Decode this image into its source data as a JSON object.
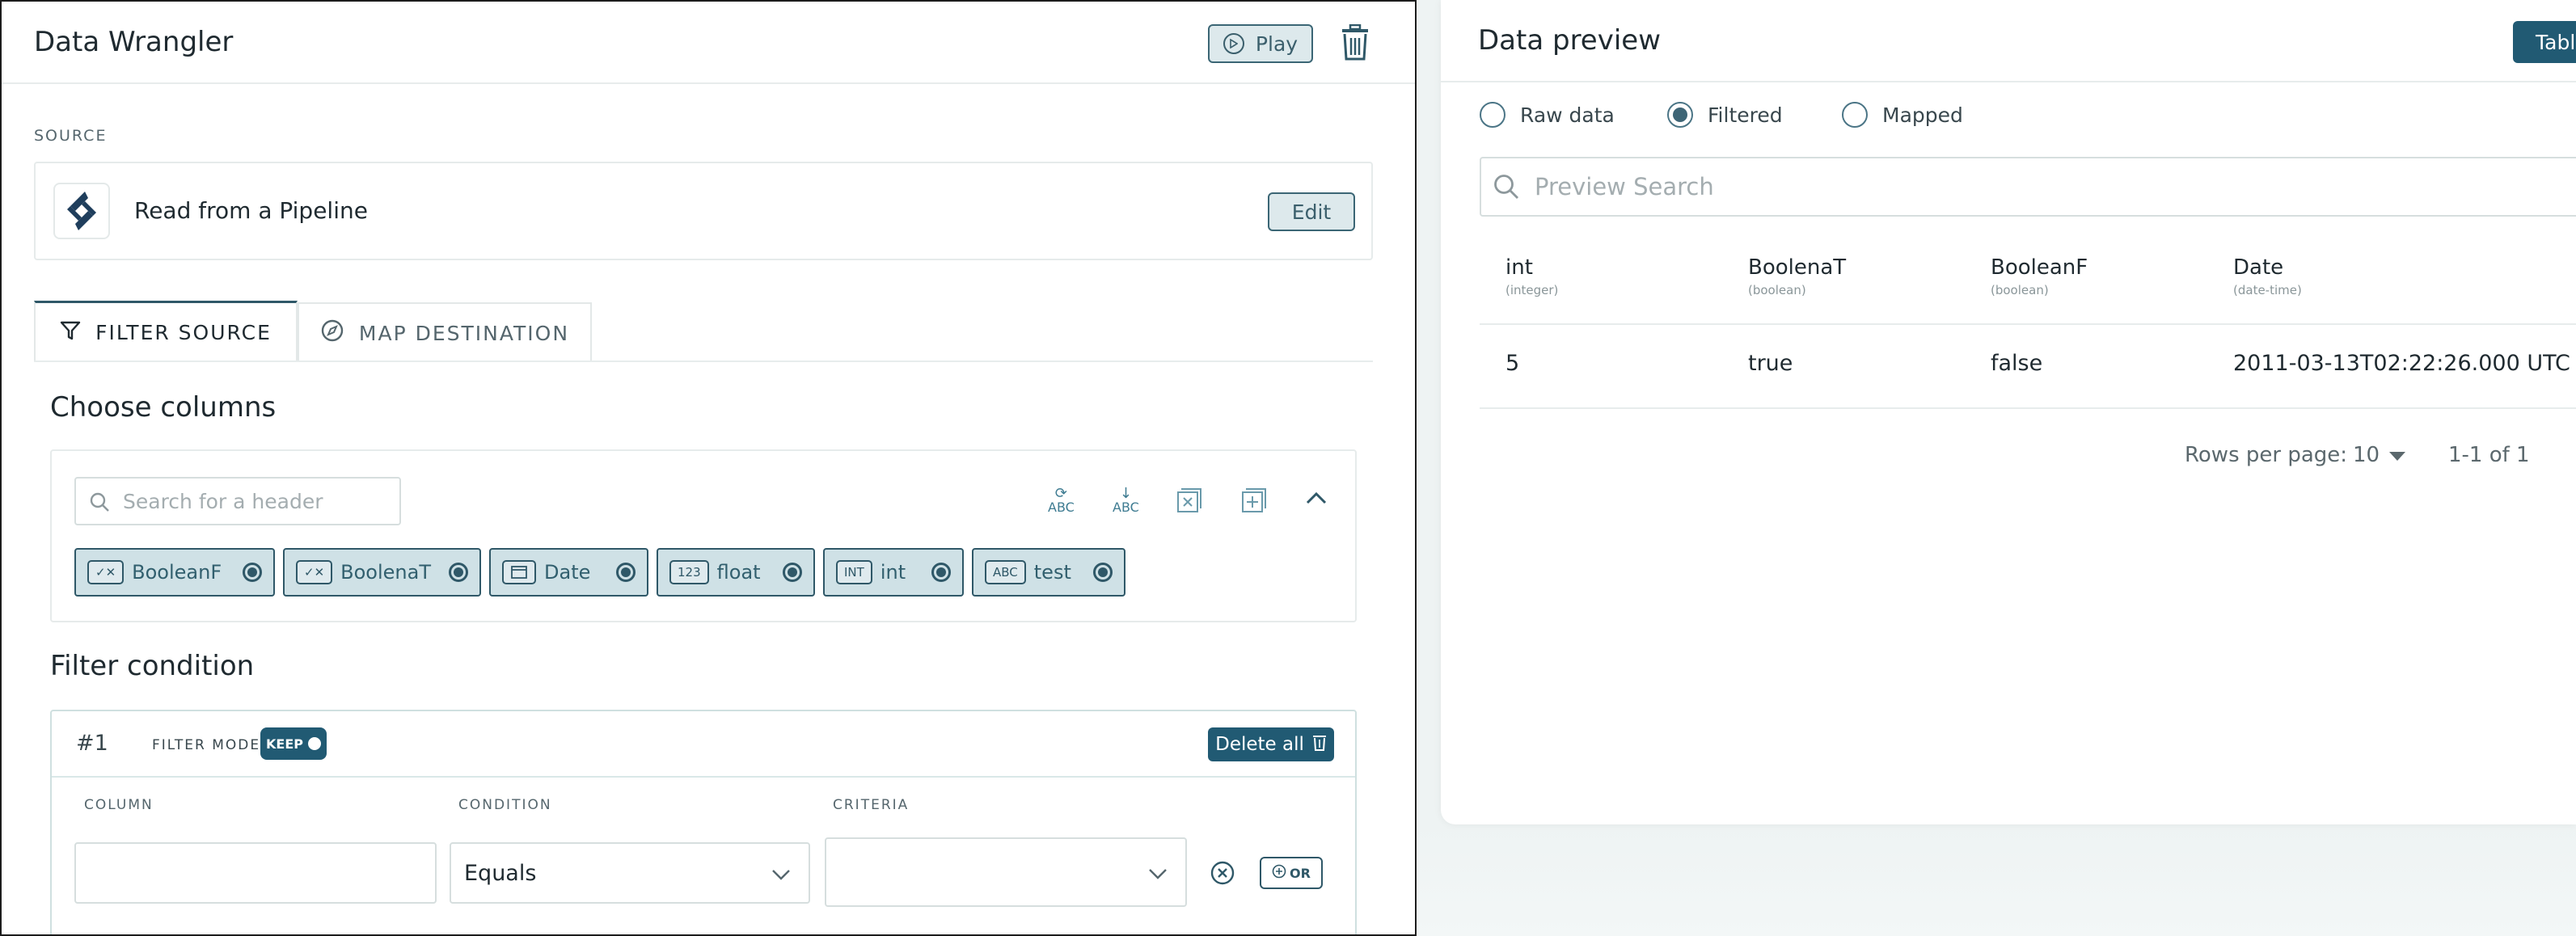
{
  "app": {
    "title": "Data Wrangler"
  },
  "header": {
    "play_label": "Play",
    "delete_icon": "trash-icon"
  },
  "source": {
    "section_label": "SOURCE",
    "pipeline_label": "Read from a Pipeline",
    "edit_label": "Edit"
  },
  "tabs": [
    {
      "label": "FILTER SOURCE",
      "icon": "filter-icon",
      "active": true
    },
    {
      "label": "MAP DESTINATION",
      "icon": "compass-icon",
      "active": false
    }
  ],
  "choose_columns": {
    "title": "Choose columns",
    "search_placeholder": "Search for a header",
    "tool_abc": "ABC",
    "columns": [
      {
        "tag": "✓✕",
        "label": "BooleanF"
      },
      {
        "tag": "✓✕",
        "label": "BoolenaT"
      },
      {
        "tag": "📅",
        "label": "Date"
      },
      {
        "tag": "123",
        "label": "float"
      },
      {
        "tag": "INT",
        "label": "int"
      },
      {
        "tag": "ABC",
        "label": "test"
      }
    ]
  },
  "filter": {
    "title": "Filter condition",
    "index": "#1",
    "mode_label": "FILTER MODE",
    "mode_value": "KEEP",
    "delete_all_label": "Delete all",
    "col_column": "COLUMN",
    "col_condition": "CONDITION",
    "col_criteria": "CRITERIA",
    "column_value": "",
    "condition_value": "Equals",
    "criteria_value": "",
    "or_label": "OR"
  },
  "preview": {
    "title": "Data preview",
    "table_button": "Tabl",
    "radio_options": [
      "Raw data",
      "Filtered",
      "Mapped"
    ],
    "selected": "Filtered",
    "search_placeholder": "Preview Search",
    "headers": [
      {
        "name": "int",
        "type": "(integer)"
      },
      {
        "name": "BoolenaT",
        "type": "(boolean)"
      },
      {
        "name": "BooleanF",
        "type": "(boolean)"
      },
      {
        "name": "Date",
        "type": "(date-time)"
      }
    ],
    "rows": [
      [
        "5",
        "true",
        "false",
        "2011-03-13T02:22:26.000 UTC"
      ]
    ],
    "rows_per_page_label": "Rows per page:",
    "rows_per_page_value": "10",
    "range": "1-1 of 1"
  }
}
